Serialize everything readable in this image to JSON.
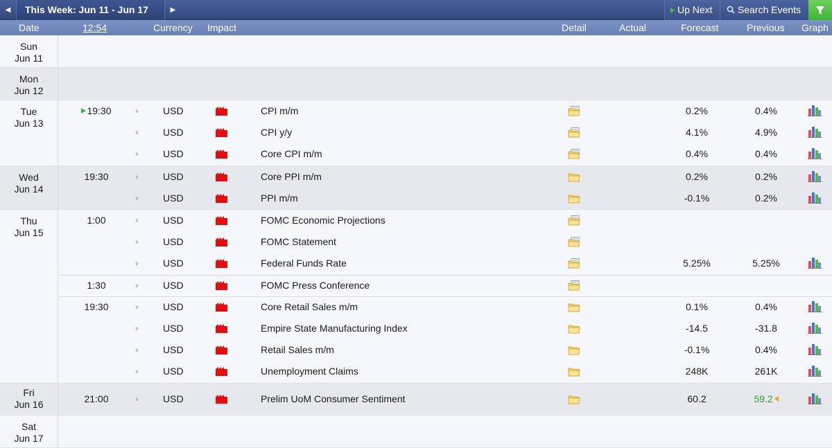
{
  "toolbar": {
    "week_title": "This Week: Jun 11 - Jun 17",
    "up_next": "Up Next",
    "search_events": "Search Events"
  },
  "columns": {
    "date": "Date",
    "clock": "12:54",
    "currency": "Currency",
    "impact": "Impact",
    "detail": "Detail",
    "actual": "Actual",
    "forecast": "Forecast",
    "previous": "Previous",
    "graph": "Graph"
  },
  "days": [
    {
      "weekday": "Sun",
      "date": "Jun 11",
      "events": []
    },
    {
      "weekday": "Mon",
      "date": "Jun 12",
      "events": []
    },
    {
      "weekday": "Tue",
      "date": "Jun 13",
      "events": [
        {
          "time": "19:30",
          "currency": "USD",
          "event": "CPI m/m",
          "actual": "",
          "forecast": "0.2%",
          "previous": "0.4%"
        },
        {
          "time": "",
          "currency": "USD",
          "event": "CPI y/y",
          "actual": "",
          "forecast": "4.1%",
          "previous": "4.9%"
        },
        {
          "time": "",
          "currency": "USD",
          "event": "Core CPI m/m",
          "actual": "",
          "forecast": "0.4%",
          "previous": "0.4%"
        }
      ]
    },
    {
      "weekday": "Wed",
      "date": "Jun 14",
      "events": [
        {
          "time": "19:30",
          "currency": "USD",
          "event": "Core PPI m/m",
          "actual": "",
          "forecast": "0.2%",
          "previous": "0.2%"
        },
        {
          "time": "",
          "currency": "USD",
          "event": "PPI m/m",
          "actual": "",
          "forecast": "-0.1%",
          "previous": "0.2%"
        }
      ]
    },
    {
      "weekday": "Thu",
      "date": "Jun 15",
      "events": [
        {
          "time": "1:00",
          "currency": "USD",
          "event": "FOMC Economic Projections",
          "actual": "",
          "forecast": "",
          "previous": ""
        },
        {
          "time": "",
          "currency": "USD",
          "event": "FOMC Statement",
          "actual": "",
          "forecast": "",
          "previous": ""
        },
        {
          "time": "",
          "currency": "USD",
          "event": "Federal Funds Rate",
          "actual": "",
          "forecast": "5.25%",
          "previous": "5.25%"
        },
        {
          "time": "1:30",
          "currency": "USD",
          "event": "FOMC Press Conference",
          "actual": "",
          "forecast": "",
          "previous": ""
        },
        {
          "time": "19:30",
          "currency": "USD",
          "event": "Core Retail Sales m/m",
          "actual": "",
          "forecast": "0.1%",
          "previous": "0.4%"
        },
        {
          "time": "",
          "currency": "USD",
          "event": "Empire State Manufacturing Index",
          "actual": "",
          "forecast": "-14.5",
          "previous": "-31.8"
        },
        {
          "time": "",
          "currency": "USD",
          "event": "Retail Sales m/m",
          "actual": "",
          "forecast": "-0.1%",
          "previous": "0.4%"
        },
        {
          "time": "",
          "currency": "USD",
          "event": "Unemployment Claims",
          "actual": "",
          "forecast": "248K",
          "previous": "261K"
        }
      ]
    },
    {
      "weekday": "Fri",
      "date": "Jun 16",
      "events": [
        {
          "time": "21:00",
          "currency": "USD",
          "event": "Prelim UoM Consumer Sentiment",
          "actual": "",
          "forecast": "60.2",
          "previous": "59.2"
        }
      ]
    },
    {
      "weekday": "Sat",
      "date": "Jun 17",
      "events": []
    }
  ],
  "colors": {
    "impact_high": "#e01010",
    "previous_revised_up": "#2aa52a",
    "header_bg": "#3e5591",
    "up_next_marker": "#3fb536"
  }
}
